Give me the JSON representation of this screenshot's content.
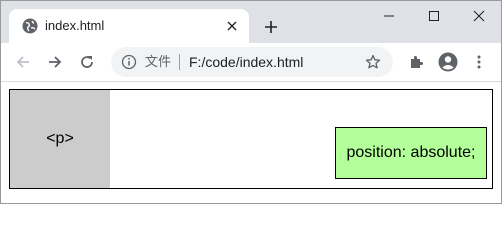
{
  "browser": {
    "tab": {
      "title": "index.html",
      "favicon": "globe-icon",
      "close_icon": "close-icon"
    },
    "new_tab_icon": "plus-icon",
    "window_controls": [
      "minimize-icon",
      "maximize-icon",
      "close-icon"
    ],
    "nav": [
      "back-arrow-icon",
      "forward-arrow-icon",
      "reload-icon"
    ],
    "omnibox": {
      "info_icon": "info-icon",
      "scheme_label": "文件",
      "url": "F:/code/index.html",
      "bookmark_icon": "star-icon"
    },
    "toolbar_icons": [
      "extensions-puzzle-icon",
      "profile-avatar-icon",
      "menu-kebab-icon"
    ]
  },
  "page": {
    "p_text": "<p>",
    "absolute_text": "position: absolute;",
    "colors": {
      "p_background": "#cccccc",
      "absolute_background": "#b3ff99",
      "border": "#000000"
    }
  }
}
